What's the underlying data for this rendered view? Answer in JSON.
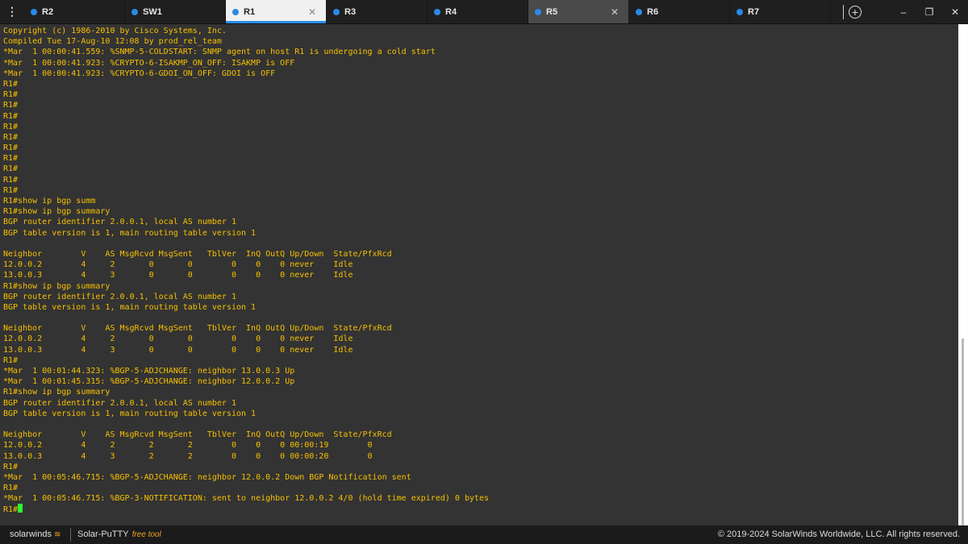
{
  "tabs": [
    {
      "label": "R2",
      "state": "normal",
      "close": false
    },
    {
      "label": "SW1",
      "state": "normal",
      "close": false
    },
    {
      "label": "R1",
      "state": "active",
      "close": true
    },
    {
      "label": "R3",
      "state": "normal",
      "close": false
    },
    {
      "label": "R4",
      "state": "normal",
      "close": false
    },
    {
      "label": "R5",
      "state": "hover",
      "close": true
    },
    {
      "label": "R6",
      "state": "normal",
      "close": false
    },
    {
      "label": "R7",
      "state": "normal",
      "close": false
    }
  ],
  "icons": {
    "menu": "⋮",
    "close": "✕",
    "add": "+",
    "minimize": "–",
    "restore": "❐",
    "window_close": "✕"
  },
  "colors": {
    "terminal_text": "#f6c000",
    "terminal_bg": "#333333",
    "accent": "#2b8ae8",
    "cursor": "#2cff2c",
    "brand_orange": "#f5a623"
  },
  "terminal": {
    "lines": [
      "Copyright (c) 1986-2010 by Cisco Systems, Inc.",
      "Compiled Tue 17-Aug-10 12:08 by prod_rel_team",
      "*Mar  1 00:00:41.559: %SNMP-5-COLDSTART: SNMP agent on host R1 is undergoing a cold start",
      "*Mar  1 00:00:41.923: %CRYPTO-6-ISAKMP_ON_OFF: ISAKMP is OFF",
      "*Mar  1 00:00:41.923: %CRYPTO-6-GDOI_ON_OFF: GDOI is OFF",
      "R1#",
      "R1#",
      "R1#",
      "R1#",
      "R1#",
      "R1#",
      "R1#",
      "R1#",
      "R1#",
      "R1#",
      "R1#",
      "R1#show ip bgp summ",
      "R1#show ip bgp summary",
      "BGP router identifier 2.0.0.1, local AS number 1",
      "BGP table version is 1, main routing table version 1",
      "",
      "Neighbor        V    AS MsgRcvd MsgSent   TblVer  InQ OutQ Up/Down  State/PfxRcd",
      "12.0.0.2        4     2       0       0        0    0    0 never    Idle",
      "13.0.0.3        4     3       0       0        0    0    0 never    Idle",
      "R1#show ip bgp summary",
      "BGP router identifier 2.0.0.1, local AS number 1",
      "BGP table version is 1, main routing table version 1",
      "",
      "Neighbor        V    AS MsgRcvd MsgSent   TblVer  InQ OutQ Up/Down  State/PfxRcd",
      "12.0.0.2        4     2       0       0        0    0    0 never    Idle",
      "13.0.0.3        4     3       0       0        0    0    0 never    Idle",
      "R1#",
      "*Mar  1 00:01:44.323: %BGP-5-ADJCHANGE: neighbor 13.0.0.3 Up",
      "*Mar  1 00:01:45.315: %BGP-5-ADJCHANGE: neighbor 12.0.0.2 Up",
      "R1#show ip bgp summary",
      "BGP router identifier 2.0.0.1, local AS number 1",
      "BGP table version is 1, main routing table version 1",
      "",
      "Neighbor        V    AS MsgRcvd MsgSent   TblVer  InQ OutQ Up/Down  State/PfxRcd",
      "12.0.0.2        4     2       2       2        0    0    0 00:00:19        0",
      "13.0.0.3        4     3       2       2        0    0    0 00:00:20        0",
      "R1#",
      "*Mar  1 00:05:46.715: %BGP-5-ADJCHANGE: neighbor 12.0.0.2 Down BGP Notification sent",
      "R1#",
      "*Mar  1 00:05:46.715: %BGP-3-NOTIFICATION: sent to neighbor 12.0.0.2 4/0 (hold time expired) 0 bytes"
    ],
    "prompt": "R1#"
  },
  "footer": {
    "logo": "solarwinds",
    "product": "Solar-PuTTY",
    "product_suffix": "free tool",
    "copyright": "© 2019-2024 SolarWinds Worldwide, LLC. All rights reserved."
  }
}
